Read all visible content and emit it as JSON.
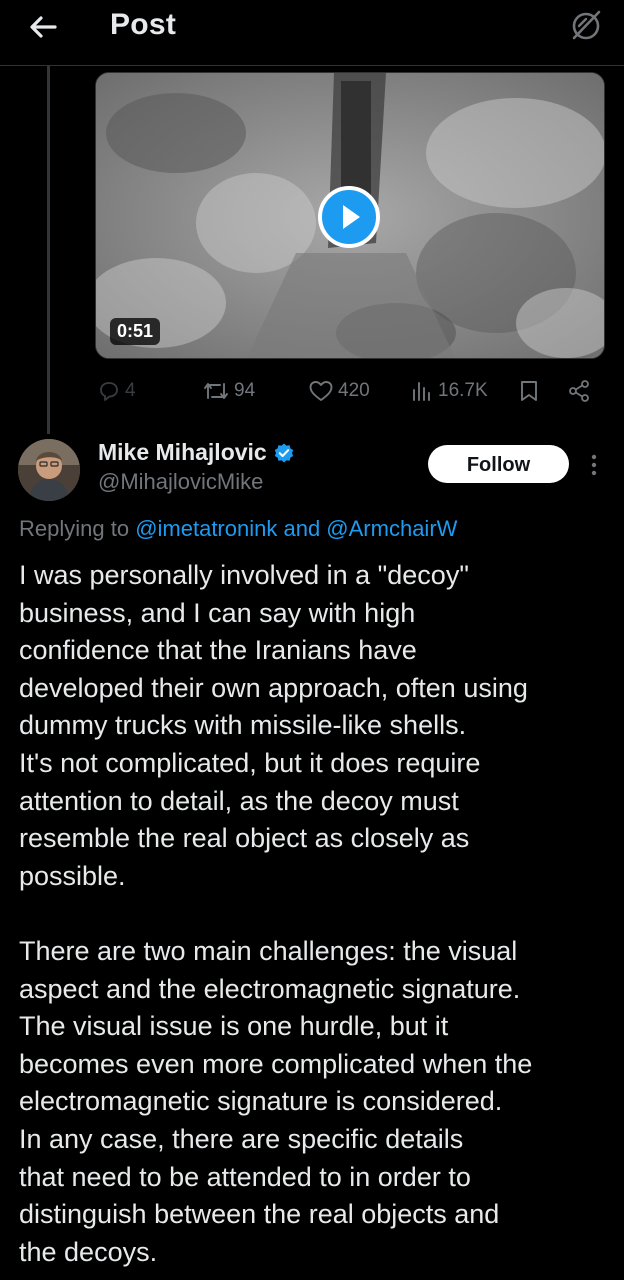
{
  "header": {
    "title": "Post"
  },
  "media": {
    "duration": "0:51"
  },
  "actions": {
    "replies": "4",
    "reposts": "94",
    "likes": "420",
    "views": "16.7K"
  },
  "author": {
    "name": "Mike Mihajlovic",
    "handle": "@MihajlovicMike",
    "follow_label": "Follow"
  },
  "reply": {
    "prefix": "Replying to ",
    "mention1": "@imetatronink",
    "joiner": " and ",
    "mention2": "@ArmchairW"
  },
  "body": {
    "paragraph1": [
      "I was personally involved in a \"decoy\"",
      "business, and I can say with high",
      "confidence that the Iranians have",
      "developed their own approach, often using",
      "dummy trucks with missile-like shells.",
      "It's not complicated, but it does require",
      "attention to detail, as the decoy must",
      "resemble the real object as closely as",
      "possible."
    ],
    "paragraph2": [
      "There are two main challenges: the visual",
      "aspect and the electromagnetic signature.",
      "The visual issue is one hurdle, but it",
      "becomes even more complicated when the",
      "electromagnetic signature is considered.",
      "In any case, there are specific details",
      "that need to be attended to in order to",
      "distinguish between the real objects and",
      "the decoys."
    ]
  },
  "colors": {
    "accent": "#1d9bf0",
    "muted": "#71767b",
    "background": "#000000",
    "text": "#e7e9ea"
  }
}
